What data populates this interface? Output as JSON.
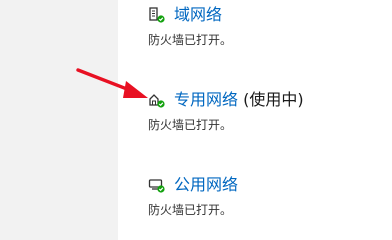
{
  "networks": [
    {
      "name": "域网络",
      "suffix": "",
      "status": "防火墙已打开。",
      "icon": "domain-network-icon"
    },
    {
      "name": "专用网络",
      "suffix": "(使用中)",
      "status": "防火墙已打开。",
      "icon": "private-network-icon"
    },
    {
      "name": "公用网络",
      "suffix": "",
      "status": "防火墙已打开。",
      "icon": "public-network-icon"
    }
  ],
  "colors": {
    "link": "#0067c0",
    "text": "#1a1a1a",
    "sidebar": "#f2f2f2",
    "check": "#13a10e",
    "annotation_arrow": "#e81123"
  }
}
